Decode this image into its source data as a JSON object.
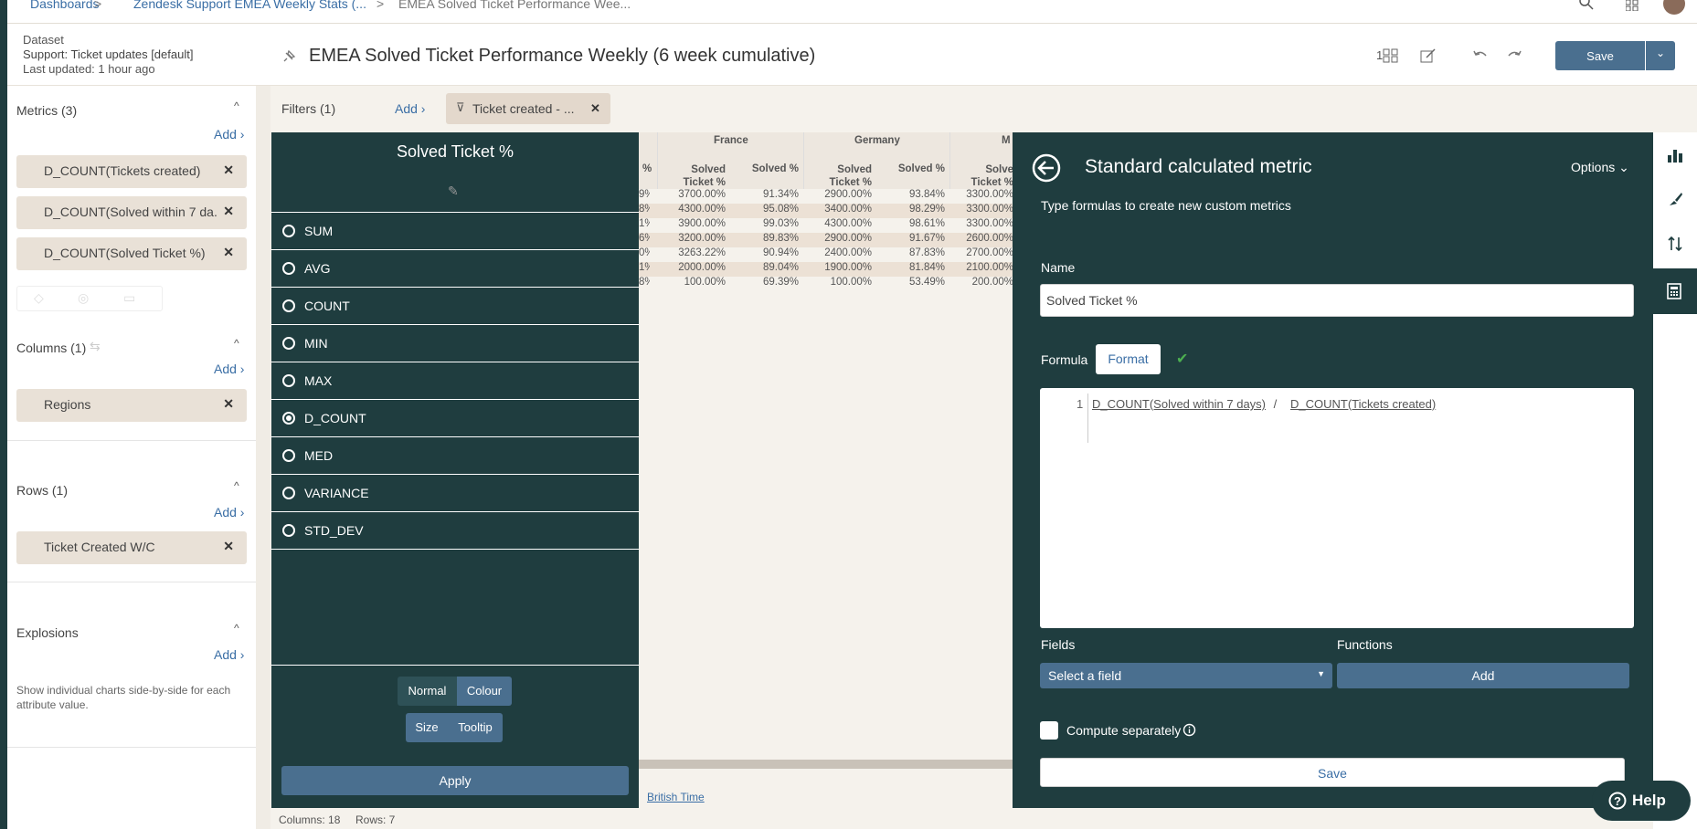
{
  "breadcrumb": {
    "dashboards": "Dashboards",
    "sep1": ">",
    "parent": "Zendesk Support EMEA Weekly Stats (...",
    "sep2": ">",
    "current": "EMEA Solved Ticket Performance Wee..."
  },
  "dataset": {
    "label": "Dataset",
    "name": "Support: Ticket updates [default]",
    "updated": "Last updated: 1 hour ago"
  },
  "header": {
    "title": "EMEA Solved Ticket Performance Weekly (6 week cumulative)",
    "layout_count": "1",
    "save_label": "Save"
  },
  "metrics": {
    "title": "Metrics (3)",
    "add": "Add ›",
    "items": [
      "D_COUNT(Tickets created)",
      "D_COUNT(Solved within 7 da...",
      "D_COUNT(Solved Ticket %)"
    ]
  },
  "columns": {
    "title": "Columns (1)",
    "add": "Add ›",
    "items": [
      "Regions"
    ]
  },
  "rows": {
    "title": "Rows (1)",
    "add": "Add ›",
    "items": [
      "Ticket Created W/C"
    ]
  },
  "explosions": {
    "title": "Explosions",
    "add": "Add ›",
    "desc": "Show individual charts side-by-side for each attribute value."
  },
  "filters": {
    "title": "Filters (1)",
    "add": "Add ›",
    "chip": "Ticket created - ..."
  },
  "agg_panel": {
    "title": "Solved Ticket %",
    "options": [
      "SUM",
      "AVG",
      "COUNT",
      "MIN",
      "MAX",
      "D_COUNT",
      "MED",
      "VARIANCE",
      "STD_DEV"
    ],
    "selected": "D_COUNT",
    "mode_normal": "Normal",
    "mode_colour": "Colour",
    "mode_size": "Size",
    "mode_tooltip": "Tooltip",
    "apply": "Apply"
  },
  "table": {
    "regions": [
      "France",
      "Germany",
      "M"
    ],
    "headers": [
      "%",
      "Solved Ticket %",
      "Solved %",
      "Solved Ticket %",
      "Solved %",
      "Solve Ticket %"
    ],
    "rows": [
      [
        "9%",
        "3700.00%",
        "91.34%",
        "2900.00%",
        "93.84%",
        "3300.00%"
      ],
      [
        "8%",
        "4300.00%",
        "95.08%",
        "3400.00%",
        "98.29%",
        "3300.00%"
      ],
      [
        "1%",
        "3900.00%",
        "99.03%",
        "4300.00%",
        "98.61%",
        "3300.00%"
      ],
      [
        "6%",
        "3200.00%",
        "89.83%",
        "2900.00%",
        "91.67%",
        "2600.00%"
      ],
      [
        "0%",
        "3263.22%",
        "90.94%",
        "2400.00%",
        "87.83%",
        "2700.00%"
      ],
      [
        "1%",
        "2000.00%",
        "89.04%",
        "1900.00%",
        "81.84%",
        "2100.00%"
      ],
      [
        "8%",
        "100.00%",
        "69.39%",
        "100.00%",
        "53.49%",
        "200.00%"
      ]
    ],
    "timezone": "British Time"
  },
  "calc": {
    "title": "Standard calculated metric",
    "options": "Options",
    "subtitle": "Type formulas to create new custom metrics",
    "name_label": "Name",
    "name_value": "Solved Ticket %",
    "formula_label": "Formula",
    "format_label": "Format",
    "line_no": "1",
    "formula_part1": "D_COUNT(Solved within 7 days)",
    "formula_op": " / ",
    "formula_part2": "D_COUNT(Tickets created)",
    "fields_label": "Fields",
    "fields_select": "Select a field",
    "functions_label": "Functions",
    "functions_add": "Add",
    "compute_label": "Compute separately",
    "save": "Save"
  },
  "status": {
    "columns": "Columns: 18",
    "rows": "Rows: 7"
  },
  "help": "Help"
}
